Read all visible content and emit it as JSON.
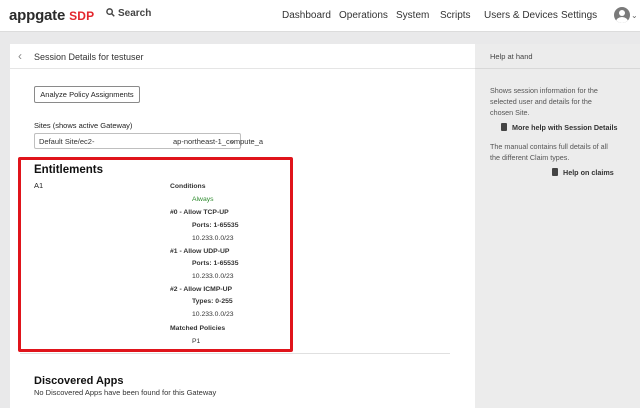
{
  "brand": {
    "name": "appgate",
    "product": "SDP"
  },
  "search": {
    "label": "Search",
    "icon": "search-icon"
  },
  "nav": [
    "Dashboard",
    "Operations",
    "System",
    "Scripts",
    "Users & Devices",
    "Settings"
  ],
  "session": {
    "title": "Session Details for testuser",
    "analyze_button": "Analyze Policy Assignments",
    "sites_label": "Sites (shows active Gateway)",
    "site_value_prefix": "Default Site/ec2-",
    "site_value_suffix": "ap-northeast-1_compute_a"
  },
  "entitlements": {
    "heading": "Entitlements",
    "name": "A1",
    "conditions_label": "Conditions",
    "condition": "Always",
    "actions": [
      {
        "title": "#0 - Allow TCP-UP",
        "detail": "Ports: 1-65535",
        "subnet": "10.233.0.0/23"
      },
      {
        "title": "#1 - Allow UDP-UP",
        "detail": "Ports: 1-65535",
        "subnet": "10.233.0.0/23"
      },
      {
        "title": "#2 - Allow ICMP-UP",
        "detail": "Types: 0-255",
        "subnet": "10.233.0.0/23"
      }
    ],
    "matched_label": "Matched Policies",
    "matched_policy": "P1"
  },
  "discovered": {
    "heading": "Discovered Apps",
    "empty_text": "No Discovered Apps have been found for this Gateway"
  },
  "help": {
    "title": "Help at hand",
    "para1": [
      "Shows session information for the",
      "selected user and details for the",
      "chosen Site."
    ],
    "link1": "More help with Session Details",
    "para2": [
      "The manual contains full details of all",
      "the different Claim types."
    ],
    "link2": "Help on claims"
  },
  "colors": {
    "accent_red": "#e0141b",
    "brand_red": "#e3262d",
    "condition_green": "#2e8b2e"
  }
}
